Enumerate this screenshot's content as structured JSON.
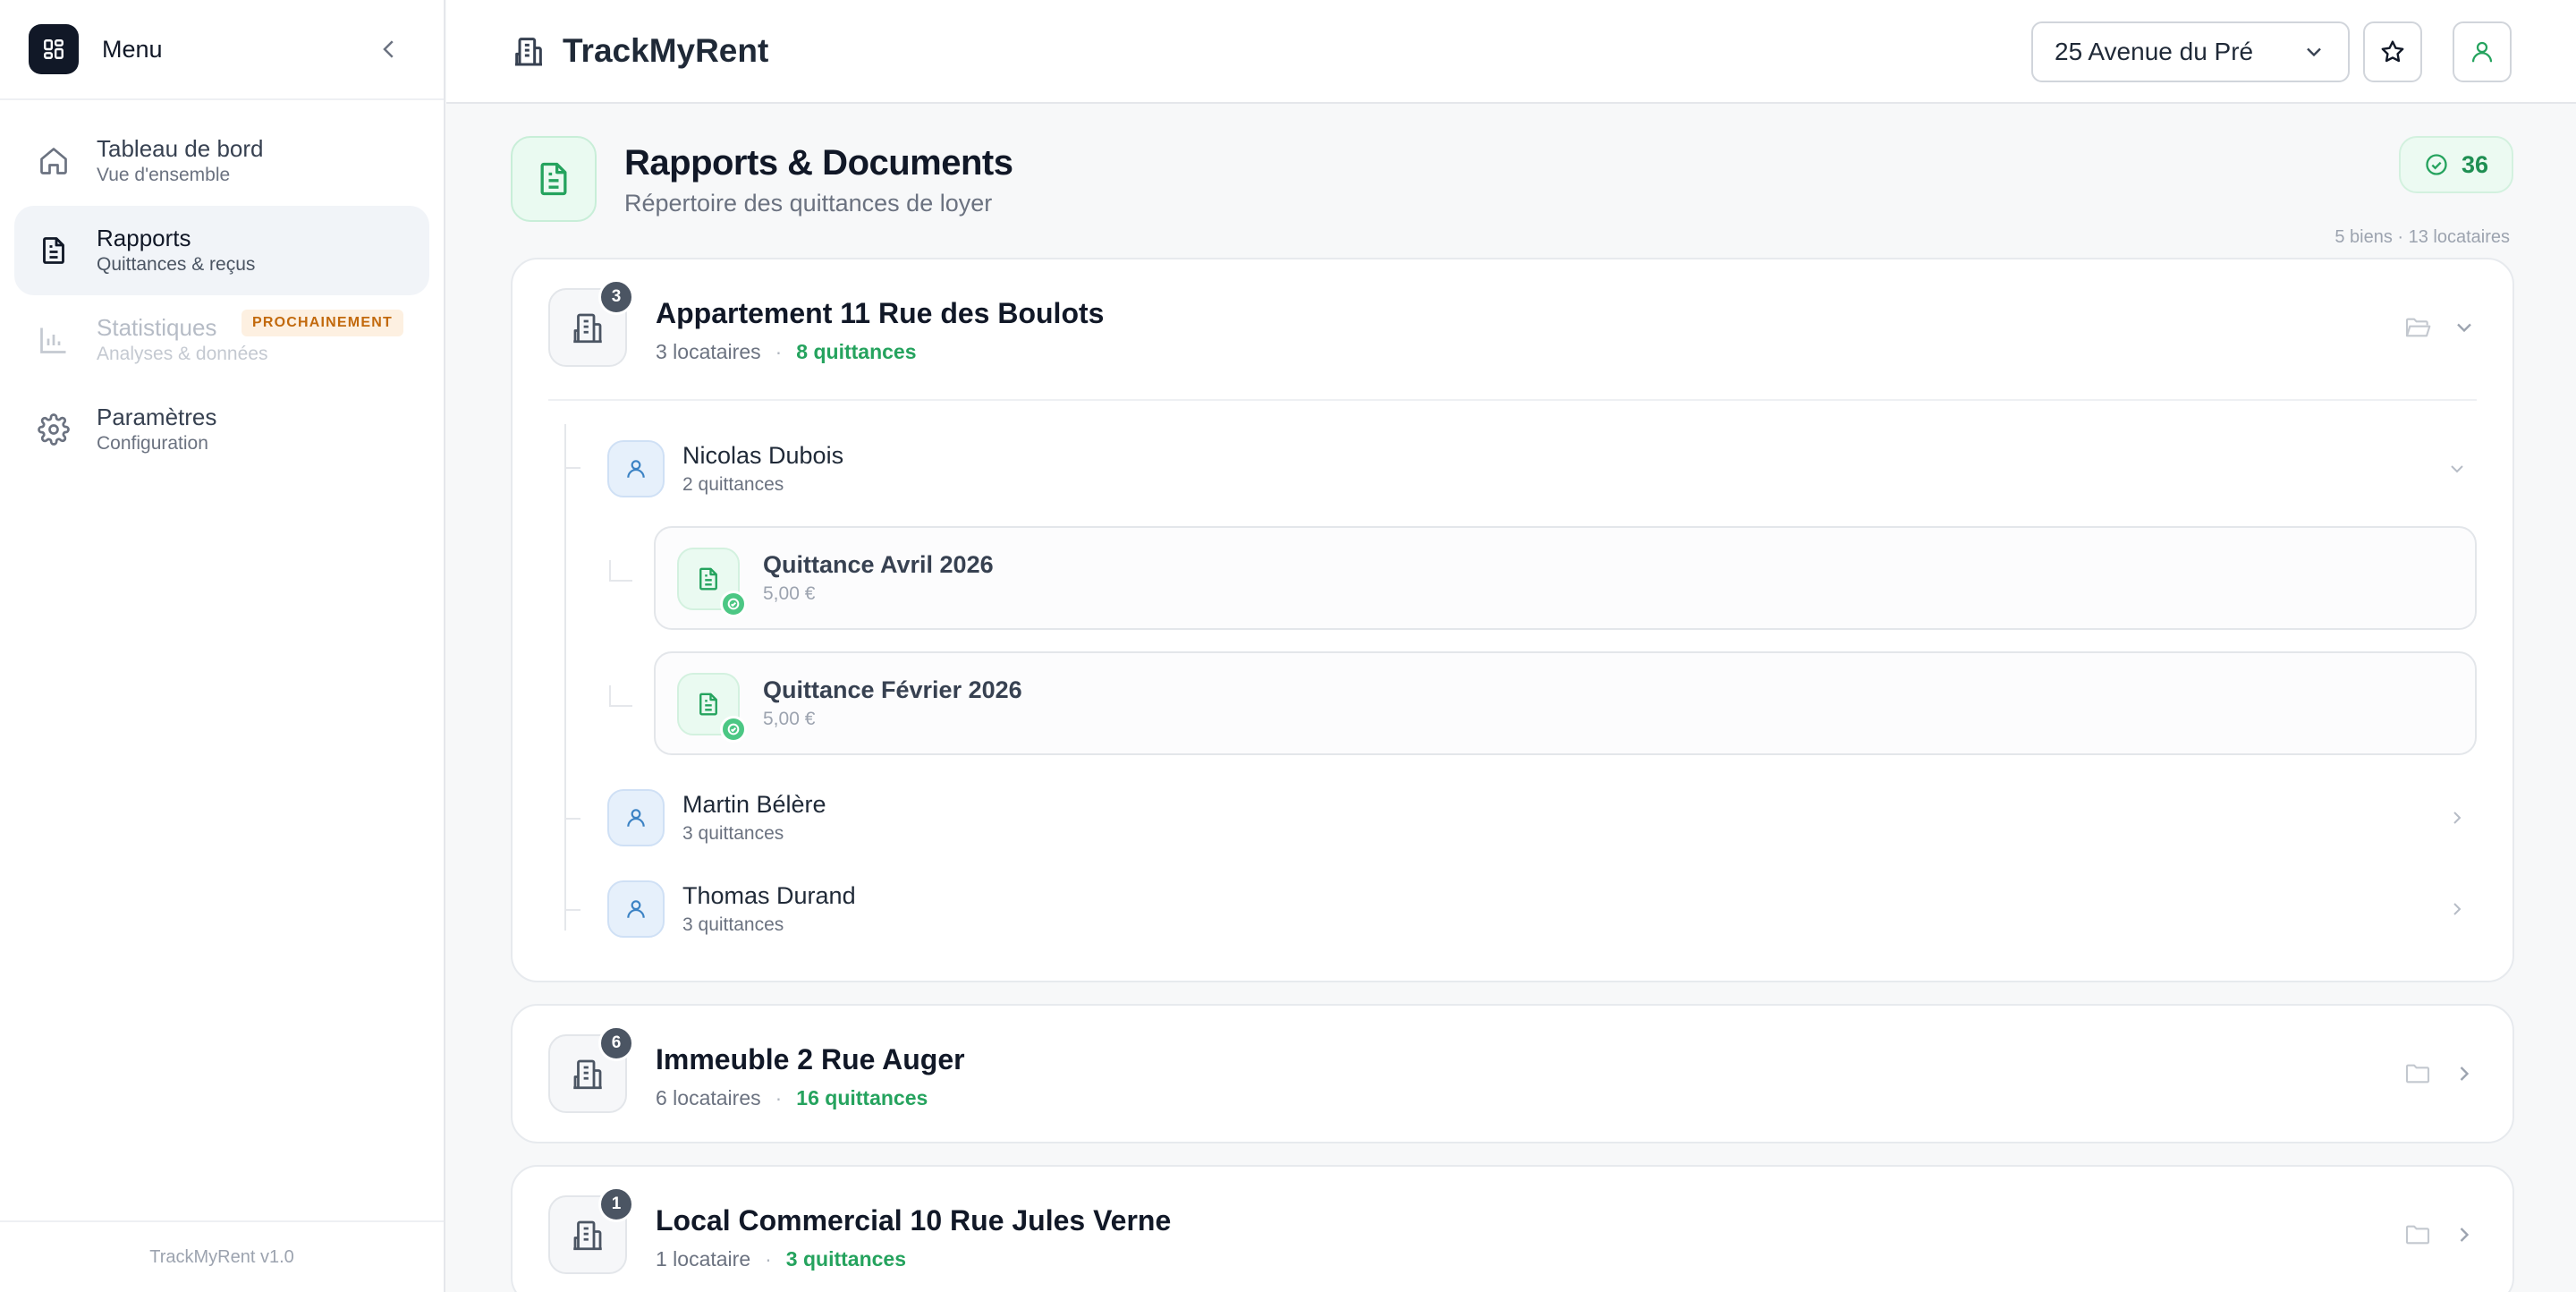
{
  "sidebar": {
    "title": "Menu",
    "items": [
      {
        "label": "Tableau de bord",
        "sub": "Vue d'ensemble"
      },
      {
        "label": "Rapports",
        "sub": "Quittances & reçus"
      },
      {
        "label": "Statistiques",
        "sub": "Analyses & données",
        "badge": "PROCHAINEMENT"
      },
      {
        "label": "Paramètres",
        "sub": "Configuration"
      }
    ],
    "footer": "TrackMyRent v1.0"
  },
  "topbar": {
    "brand": "TrackMyRent",
    "property_select": "25 Avenue du Pré"
  },
  "page": {
    "title": "Rapports & Documents",
    "subtitle": "Répertoire des quittances de loyer",
    "count": "36",
    "meta": "5 biens · 13 locataires"
  },
  "properties": [
    {
      "name": "Appartement 11 Rue des Boulots",
      "count": "3",
      "tenants": "3 locataires",
      "receipts": "8 quittances",
      "expanded": [
        {
          "name": "Nicolas Dubois",
          "receipts": "2 quittances",
          "items": [
            {
              "title": "Quittance Avril 2026",
              "amount": "5,00 €"
            },
            {
              "title": "Quittance Février 2026",
              "amount": "5,00 €"
            }
          ]
        },
        {
          "name": "Martin Bélère",
          "receipts": "3 quittances"
        },
        {
          "name": "Thomas Durand",
          "receipts": "3 quittances"
        }
      ]
    },
    {
      "name": "Immeuble 2 Rue Auger",
      "count": "6",
      "tenants": "6 locataires",
      "receipts": "16 quittances"
    },
    {
      "name": "Local Commercial 10 Rue Jules Verne",
      "count": "1",
      "tenants": "1 locataire",
      "receipts": "3 quittances"
    }
  ],
  "colors": {
    "accent_green": "#25a35e",
    "sidebar_active_bg": "#f1f4f8",
    "badge_orange": "#c2690c",
    "dark": "#111827"
  },
  "icons": [
    "dashboard-grid-icon",
    "chevron-left-icon",
    "home-icon",
    "document-icon",
    "bar-chart-icon",
    "gear-icon",
    "building-icon",
    "chevron-down-icon",
    "star-icon",
    "user-icon",
    "check-circle-icon",
    "folder-icon",
    "chevron-right-icon"
  ]
}
